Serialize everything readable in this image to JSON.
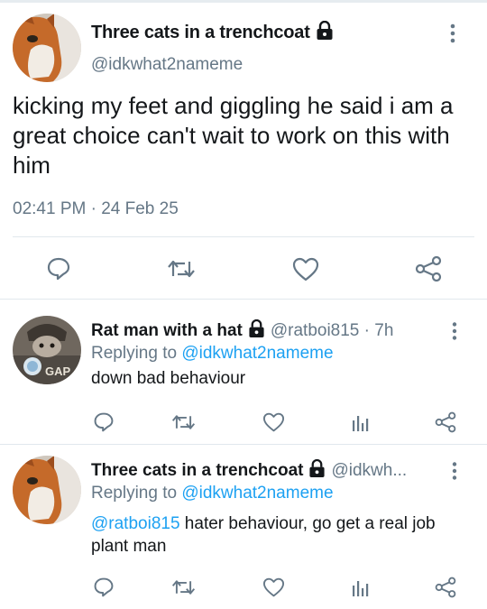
{
  "main_tweet": {
    "display_name": "Three cats in a trenchcoat",
    "handle": "@idkwhat2nameme",
    "text": "kicking my feet and giggling he said i am a great choice can't wait to work on this with him",
    "timestamp": "02:41 PM · 24 Feb 25",
    "icons": [
      "reply-icon",
      "retweet-icon",
      "like-icon",
      "share-icon"
    ]
  },
  "replies": [
    {
      "display_name": "Rat man with a hat",
      "meta": "@ratboi815 · 7h",
      "replying_prefix": "Replying to ",
      "replying_handle": "@idkwhat2nameme",
      "mention": "",
      "text": "down bad behaviour",
      "avatar_text": "GAP"
    },
    {
      "display_name": "Three cats in a trenchcoat",
      "meta": "@idkwh...",
      "replying_prefix": "Replying to ",
      "replying_handle": "@idkwhat2nameme",
      "mention": "@ratboi815",
      "text": " hater behaviour, go get a real job plant man"
    }
  ],
  "colors": {
    "accent": "#1da1f2",
    "secondary_text": "#657786",
    "icon": "#657786",
    "divider": "#e1e8ed"
  }
}
